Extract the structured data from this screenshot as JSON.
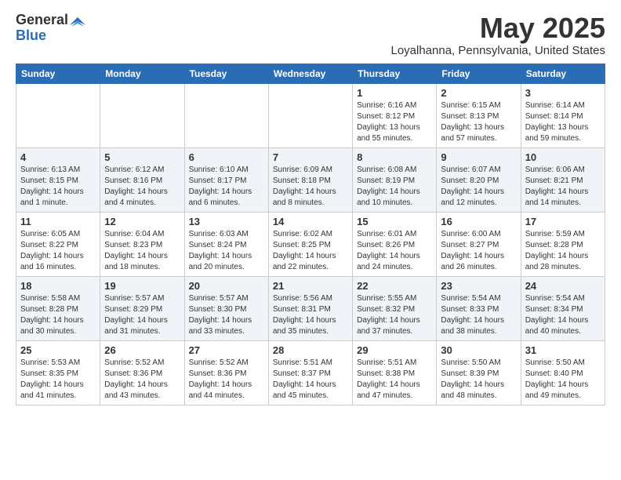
{
  "header": {
    "logo_general": "General",
    "logo_blue": "Blue",
    "title": "May 2025",
    "subtitle": "Loyalhanna, Pennsylvania, United States"
  },
  "days_of_week": [
    "Sunday",
    "Monday",
    "Tuesday",
    "Wednesday",
    "Thursday",
    "Friday",
    "Saturday"
  ],
  "weeks": [
    {
      "days": [
        {
          "number": "",
          "info": ""
        },
        {
          "number": "",
          "info": ""
        },
        {
          "number": "",
          "info": ""
        },
        {
          "number": "",
          "info": ""
        },
        {
          "number": "1",
          "info": "Sunrise: 6:16 AM\nSunset: 8:12 PM\nDaylight: 13 hours\nand 55 minutes."
        },
        {
          "number": "2",
          "info": "Sunrise: 6:15 AM\nSunset: 8:13 PM\nDaylight: 13 hours\nand 57 minutes."
        },
        {
          "number": "3",
          "info": "Sunrise: 6:14 AM\nSunset: 8:14 PM\nDaylight: 13 hours\nand 59 minutes."
        }
      ]
    },
    {
      "days": [
        {
          "number": "4",
          "info": "Sunrise: 6:13 AM\nSunset: 8:15 PM\nDaylight: 14 hours\nand 1 minute."
        },
        {
          "number": "5",
          "info": "Sunrise: 6:12 AM\nSunset: 8:16 PM\nDaylight: 14 hours\nand 4 minutes."
        },
        {
          "number": "6",
          "info": "Sunrise: 6:10 AM\nSunset: 8:17 PM\nDaylight: 14 hours\nand 6 minutes."
        },
        {
          "number": "7",
          "info": "Sunrise: 6:09 AM\nSunset: 8:18 PM\nDaylight: 14 hours\nand 8 minutes."
        },
        {
          "number": "8",
          "info": "Sunrise: 6:08 AM\nSunset: 8:19 PM\nDaylight: 14 hours\nand 10 minutes."
        },
        {
          "number": "9",
          "info": "Sunrise: 6:07 AM\nSunset: 8:20 PM\nDaylight: 14 hours\nand 12 minutes."
        },
        {
          "number": "10",
          "info": "Sunrise: 6:06 AM\nSunset: 8:21 PM\nDaylight: 14 hours\nand 14 minutes."
        }
      ]
    },
    {
      "days": [
        {
          "number": "11",
          "info": "Sunrise: 6:05 AM\nSunset: 8:22 PM\nDaylight: 14 hours\nand 16 minutes."
        },
        {
          "number": "12",
          "info": "Sunrise: 6:04 AM\nSunset: 8:23 PM\nDaylight: 14 hours\nand 18 minutes."
        },
        {
          "number": "13",
          "info": "Sunrise: 6:03 AM\nSunset: 8:24 PM\nDaylight: 14 hours\nand 20 minutes."
        },
        {
          "number": "14",
          "info": "Sunrise: 6:02 AM\nSunset: 8:25 PM\nDaylight: 14 hours\nand 22 minutes."
        },
        {
          "number": "15",
          "info": "Sunrise: 6:01 AM\nSunset: 8:26 PM\nDaylight: 14 hours\nand 24 minutes."
        },
        {
          "number": "16",
          "info": "Sunrise: 6:00 AM\nSunset: 8:27 PM\nDaylight: 14 hours\nand 26 minutes."
        },
        {
          "number": "17",
          "info": "Sunrise: 5:59 AM\nSunset: 8:28 PM\nDaylight: 14 hours\nand 28 minutes."
        }
      ]
    },
    {
      "days": [
        {
          "number": "18",
          "info": "Sunrise: 5:58 AM\nSunset: 8:28 PM\nDaylight: 14 hours\nand 30 minutes."
        },
        {
          "number": "19",
          "info": "Sunrise: 5:57 AM\nSunset: 8:29 PM\nDaylight: 14 hours\nand 31 minutes."
        },
        {
          "number": "20",
          "info": "Sunrise: 5:57 AM\nSunset: 8:30 PM\nDaylight: 14 hours\nand 33 minutes."
        },
        {
          "number": "21",
          "info": "Sunrise: 5:56 AM\nSunset: 8:31 PM\nDaylight: 14 hours\nand 35 minutes."
        },
        {
          "number": "22",
          "info": "Sunrise: 5:55 AM\nSunset: 8:32 PM\nDaylight: 14 hours\nand 37 minutes."
        },
        {
          "number": "23",
          "info": "Sunrise: 5:54 AM\nSunset: 8:33 PM\nDaylight: 14 hours\nand 38 minutes."
        },
        {
          "number": "24",
          "info": "Sunrise: 5:54 AM\nSunset: 8:34 PM\nDaylight: 14 hours\nand 40 minutes."
        }
      ]
    },
    {
      "days": [
        {
          "number": "25",
          "info": "Sunrise: 5:53 AM\nSunset: 8:35 PM\nDaylight: 14 hours\nand 41 minutes."
        },
        {
          "number": "26",
          "info": "Sunrise: 5:52 AM\nSunset: 8:36 PM\nDaylight: 14 hours\nand 43 minutes."
        },
        {
          "number": "27",
          "info": "Sunrise: 5:52 AM\nSunset: 8:36 PM\nDaylight: 14 hours\nand 44 minutes."
        },
        {
          "number": "28",
          "info": "Sunrise: 5:51 AM\nSunset: 8:37 PM\nDaylight: 14 hours\nand 45 minutes."
        },
        {
          "number": "29",
          "info": "Sunrise: 5:51 AM\nSunset: 8:38 PM\nDaylight: 14 hours\nand 47 minutes."
        },
        {
          "number": "30",
          "info": "Sunrise: 5:50 AM\nSunset: 8:39 PM\nDaylight: 14 hours\nand 48 minutes."
        },
        {
          "number": "31",
          "info": "Sunrise: 5:50 AM\nSunset: 8:40 PM\nDaylight: 14 hours\nand 49 minutes."
        }
      ]
    }
  ]
}
